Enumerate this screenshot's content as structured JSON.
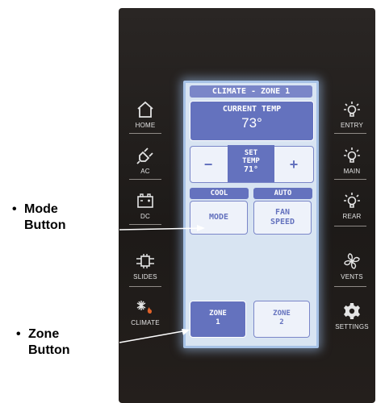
{
  "screen": {
    "title": "CLIMATE - ZONE 1",
    "current_temp_label": "CURRENT TEMP",
    "current_temp_value": "73°",
    "set_temp_line1": "SET",
    "set_temp_line2": "TEMP",
    "set_temp_value": "71°",
    "minus_label": "−",
    "plus_label": "+",
    "mode_status": "COOL",
    "fan_status": "AUTO",
    "mode_button": "MODE",
    "fan_line1": "FAN",
    "fan_line2": "SPEED",
    "zone1_line1": "ZONE",
    "zone1_line2": "1",
    "zone2_line1": "ZONE",
    "zone2_line2": "2"
  },
  "left_buttons": [
    {
      "label": "HOME",
      "icon": "house-icon"
    },
    {
      "label": "AC",
      "icon": "plug-icon"
    },
    {
      "label": "DC",
      "icon": "battery-icon"
    },
    {
      "label": "SLIDES",
      "icon": "slide-out-icon"
    },
    {
      "label": "CLIMATE",
      "icon": "snowflake-flame-icon"
    }
  ],
  "right_buttons": [
    {
      "label": "ENTRY",
      "icon": "light-bulb-icon"
    },
    {
      "label": "MAIN",
      "icon": "light-bulb-icon"
    },
    {
      "label": "REAR",
      "icon": "light-bulb-icon"
    },
    {
      "label": "VENTS",
      "icon": "fan-icon"
    },
    {
      "label": "SETTINGS",
      "icon": "gear-icon"
    }
  ],
  "callouts": {
    "mode_line1": "Mode",
    "mode_line2": "Button",
    "zone_line1": "Zone",
    "zone_line2": "Button",
    "bullet": "•"
  },
  "colors": {
    "device_bezel": "#1f1b19",
    "screen_bg": "#d8e4f2",
    "accent": "#6472be"
  }
}
